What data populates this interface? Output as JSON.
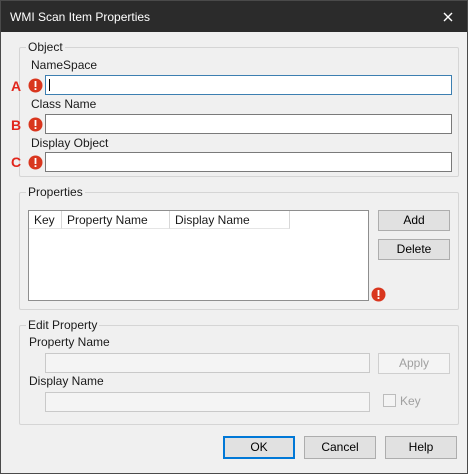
{
  "window": {
    "title": "WMI Scan Item Properties"
  },
  "object_group": {
    "legend": "Object",
    "namespace_label": "NameSpace",
    "namespace_value": "",
    "classname_label": "Class Name",
    "classname_value": "",
    "display_object_label": "Display Object",
    "display_object_value": ""
  },
  "annotations": [
    "A",
    "B",
    "C"
  ],
  "properties_group": {
    "legend": "Properties",
    "columns": [
      "Key",
      "Property Name",
      "Display Name"
    ],
    "rows": [],
    "add_label": "Add",
    "delete_label": "Delete"
  },
  "edit_group": {
    "legend": "Edit Property",
    "property_name_label": "Property Name",
    "property_name_value": "",
    "display_name_label": "Display Name",
    "display_name_value": "",
    "apply_label": "Apply",
    "key_label": "Key",
    "key_checked": false
  },
  "footer": {
    "ok_label": "OK",
    "cancel_label": "Cancel",
    "help_label": "Help"
  },
  "colors": {
    "titlebar": "#2b2b2b",
    "error": "#d9361e",
    "annotation": "#e1261c",
    "accent": "#0078d7"
  },
  "icons": {
    "close": "close-icon",
    "error": "error-icon"
  }
}
